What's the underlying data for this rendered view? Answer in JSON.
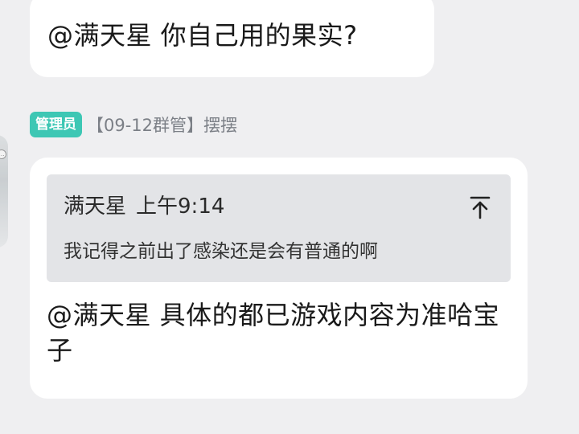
{
  "messages": [
    {
      "text": "@满天星 你自己用的果实?"
    },
    {
      "sender": {
        "role_badge": "管理员",
        "title": "【09-12群管】摆摆"
      },
      "quote": {
        "author": "满天星",
        "time": "上午9:14",
        "text": "我记得之前出了感染还是会有普通的啊",
        "jump_icon": "arrow-up-to-top-icon"
      },
      "text": "@满天星 具体的都已游戏内容为准哈宝子"
    }
  ],
  "colors": {
    "background": "#efeff1",
    "bubble": "#ffffff",
    "quote_background": "#e3e4e7",
    "role_badge": "#3dc7b4",
    "sender_title": "#7b7f86"
  }
}
